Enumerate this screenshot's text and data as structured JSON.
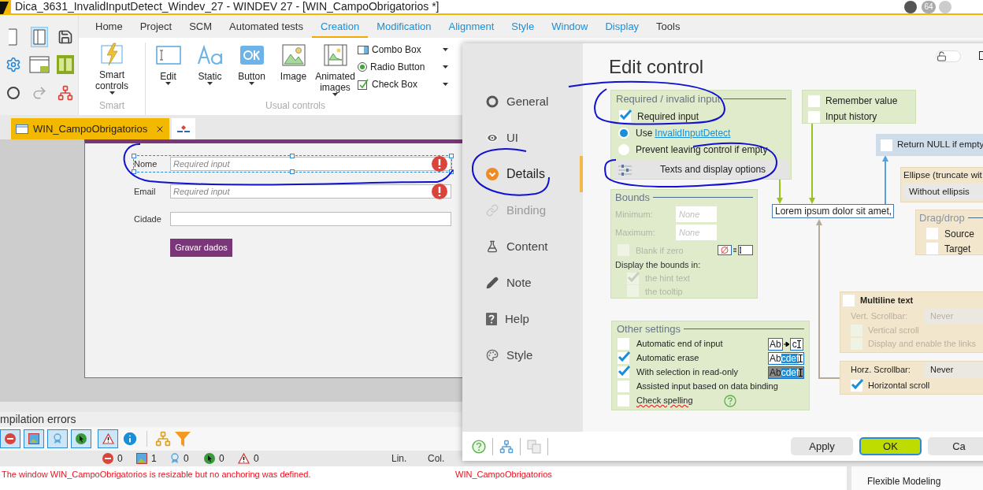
{
  "window": {
    "title": "Dica_3631_InvalidInputDetect_Windev_27 - WINDEV 27 - [WIN_CampoObrigatorios *]",
    "badge": "64"
  },
  "ribbon": {
    "tabs": [
      {
        "label": "Home",
        "selected": false
      },
      {
        "label": "Project",
        "selected": false
      },
      {
        "label": "SCM",
        "selected": false
      },
      {
        "label": "Automated tests",
        "selected": false
      },
      {
        "label": "Creation",
        "selected": true
      },
      {
        "label": "Modification",
        "selected": false
      },
      {
        "label": "Alignment",
        "selected": false
      },
      {
        "label": "Style",
        "selected": false
      },
      {
        "label": "Window",
        "selected": false
      },
      {
        "label": "Display",
        "selected": false
      },
      {
        "label": "Tools",
        "selected": false
      }
    ],
    "smart": {
      "label": "Smart controls",
      "group": "Smart"
    },
    "usual": {
      "group": "Usual controls",
      "large": [
        {
          "label": "Edit",
          "caret": true
        },
        {
          "label": "Static",
          "caret": true
        },
        {
          "label": "Button",
          "caret": true
        },
        {
          "label": "Image",
          "caret": false
        },
        {
          "label": "Animated images",
          "caret": true
        }
      ],
      "small": [
        {
          "label": "Combo Box"
        },
        {
          "label": "Radio Button"
        },
        {
          "label": "Check Box"
        }
      ]
    }
  },
  "document_tabs": [
    {
      "label": "WIN_CampoObrigatorios",
      "selected": true
    },
    {
      "selected": false
    }
  ],
  "form": {
    "fields": [
      {
        "label": "Nome",
        "placeholder": "Required input",
        "error": true,
        "selected": true
      },
      {
        "label": "Email",
        "placeholder": "Required input",
        "error": true,
        "selected": false
      },
      {
        "label": "Cidade",
        "error": false,
        "selected": false
      }
    ],
    "button": "Gravar dados"
  },
  "output_panel": {
    "title": "mpilation errors",
    "counts": [
      "0",
      "1",
      "0",
      "0",
      "0"
    ],
    "columns": [
      "Lin.",
      "Col."
    ],
    "message": "The window WIN_CampoObrigatorios is resizable but no anchoring was defined.",
    "source": "WIN_CampoObrigatorios"
  },
  "side_panel": {
    "item": "Flexible Modeling"
  },
  "dialog": {
    "title": "Edit control",
    "locked": false,
    "nav": [
      {
        "label": "General",
        "selected": false,
        "disabled": false
      },
      {
        "label": "UI",
        "selected": false,
        "disabled": false
      },
      {
        "label": "Details",
        "selected": true,
        "disabled": false
      },
      {
        "label": "Binding",
        "selected": false,
        "disabled": true
      },
      {
        "label": "Content",
        "selected": false,
        "disabled": false
      },
      {
        "label": "Note",
        "selected": false,
        "disabled": false
      },
      {
        "label": "Help",
        "selected": false,
        "disabled": false
      },
      {
        "label": "Style",
        "selected": false,
        "disabled": false
      }
    ],
    "required": {
      "title": "Required / invalid input",
      "required_input": {
        "label": "Required input",
        "checked": true
      },
      "options": [
        {
          "label": "Use",
          "link": "InvalidInputDetect",
          "selected": true
        },
        {
          "label": "Prevent leaving control if empty",
          "selected": false
        }
      ],
      "texts_button": "Texts and display options"
    },
    "memory": [
      {
        "label": "Remember value",
        "checked": false
      },
      {
        "label": "Input history",
        "checked": false
      }
    ],
    "return_null": {
      "label": "Return NULL if empty",
      "checked": false
    },
    "ellipse": {
      "title": "Ellipse (truncate wit",
      "value": "Without ellipsis"
    },
    "preview": "Lorem ipsum dolor sit amet,",
    "drag_drop": {
      "title": "Drag/drop",
      "items": [
        {
          "label": "Source",
          "checked": false
        },
        {
          "label": "Target",
          "checked": false
        }
      ]
    },
    "bounds": {
      "title": "Bounds",
      "disabled": true,
      "minimum": {
        "label": "Minimum:",
        "placeholder": "None"
      },
      "maximum": {
        "label": "Maximum:",
        "placeholder": "None"
      },
      "blank_if_zero": {
        "label": "Blank if zero",
        "checked": false
      },
      "display_label": "Display the bounds in:",
      "display": [
        {
          "label": "the hint text",
          "checked": true
        },
        {
          "label": "the tooltip",
          "checked": false
        }
      ]
    },
    "other": {
      "title": "Other settings",
      "items": [
        {
          "label": "Automatic end of input",
          "checked": false,
          "sample": {
            "kind": "arrow",
            "parts": [
              "Ab",
              "c"
            ]
          }
        },
        {
          "label": "Automatic erase",
          "checked": true,
          "sample": {
            "kind": "highlight",
            "parts": [
              "Ab",
              "cdef"
            ]
          }
        },
        {
          "label": "With selection in read-only",
          "checked": true,
          "sample": {
            "kind": "dark",
            "parts": [
              "Ab",
              "cdef"
            ]
          }
        },
        {
          "label": "Assisted input based on data binding",
          "checked": false
        },
        {
          "label": "Check spelling",
          "checked": false,
          "spelling": true
        }
      ]
    },
    "multiline": {
      "label": "Multiline text",
      "checked": false,
      "disabled": true,
      "scrollbar_label": "Vert. Scrollbar:",
      "scrollbar_value": "Never",
      "items": [
        {
          "label": "Vertical scroll",
          "checked": false
        },
        {
          "label": "Display and enable the links",
          "checked": false
        }
      ]
    },
    "horizontal": {
      "scrollbar_label": "Horz. Scrollbar:",
      "scrollbar_value": "Never",
      "scroll": {
        "label": "Horizontal scroll",
        "checked": true
      }
    },
    "buttons": [
      {
        "label": "Apply",
        "kind": "normal"
      },
      {
        "label": "OK",
        "kind": "primary"
      },
      {
        "label": "Ca",
        "kind": "normal"
      }
    ]
  }
}
